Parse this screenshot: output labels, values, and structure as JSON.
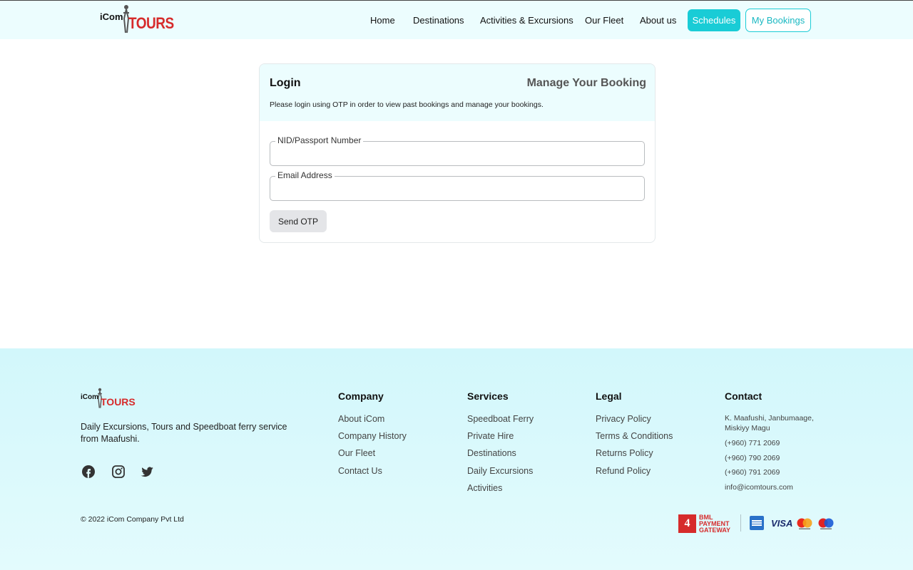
{
  "header": {
    "logo": {
      "left": "iCom",
      "right": "TOURS"
    },
    "nav": [
      "Home",
      "Destinations",
      "Activities & Excursions",
      "Our Fleet",
      "About us"
    ],
    "schedules_label": "Schedules",
    "my_bookings_label": "My Bookings",
    "accent_color": "#19ccd6"
  },
  "login": {
    "title": "Login",
    "subtitle": "Manage Your Booking",
    "description": "Please login using OTP in order to view past bookings and manage your bookings.",
    "nid_label": "NID/Passport Number",
    "nid_value": "",
    "email_label": "Email Address",
    "email_value": "",
    "send_otp_label": "Send OTP"
  },
  "footer": {
    "logo": {
      "left": "iCom",
      "right": "TOURS"
    },
    "tagline": "Daily Excursions, Tours and Speedboat ferry service from Maafushi.",
    "social": [
      "facebook-icon",
      "instagram-icon",
      "twitter-icon"
    ],
    "copyright": "© 2022 iCom Company Pvt Ltd",
    "company": {
      "title": "Company",
      "links": [
        "About iCom",
        "Company History",
        "Our Fleet",
        "Contact Us"
      ]
    },
    "services": {
      "title": "Services",
      "links": [
        "Speedboat Ferry",
        "Private Hire",
        "Destinations",
        "Daily Excursions",
        "Activities"
      ]
    },
    "legal": {
      "title": "Legal",
      "links": [
        "Privacy Policy",
        "Terms & Conditions",
        "Returns Policy",
        "Refund Policy"
      ]
    },
    "contact": {
      "title": "Contact",
      "address_line1": "K. Maafushi, Janbumaage,",
      "address_line2": "Miskiyy Magu",
      "phones": [
        "(+960) 771 2069",
        "(+960) 790 2069",
        "(+960) 791 2069"
      ],
      "email": "info@icomtours.com"
    },
    "payment": {
      "bml_line1": "BML",
      "bml_line2": "PAYMENT",
      "bml_line3": "GATEWAY",
      "cards": [
        "amex-icon",
        "visa-icon",
        "mastercard-icon",
        "maestro-icon"
      ],
      "visa_text": "VISA"
    }
  }
}
